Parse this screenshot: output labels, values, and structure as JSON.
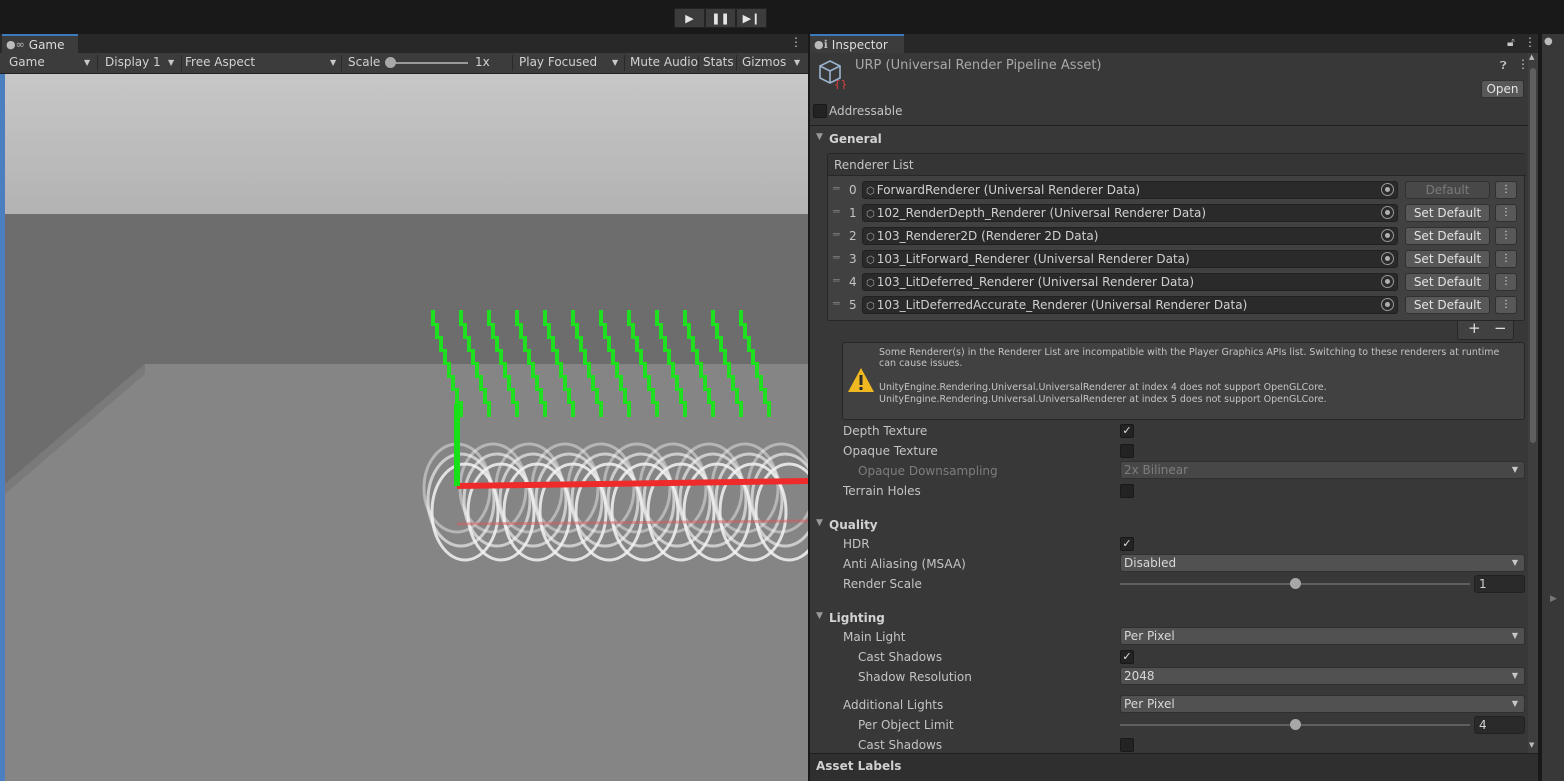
{
  "toolbar": {
    "play_icon": "play-icon",
    "pause_icon": "pause-icon",
    "step_icon": "step-icon"
  },
  "game": {
    "tab_label": "Game",
    "bar": {
      "view_select": "Game",
      "display": "Display 1",
      "aspect": "Free Aspect",
      "scale_label": "Scale",
      "scale_value": "1x",
      "scale_fraction": 0.0,
      "play_mode": "Play Focused",
      "mute_audio": "Mute Audio",
      "stats": "Stats",
      "gizmos": "Gizmos"
    }
  },
  "inspector": {
    "tab_label": "Inspector",
    "asset_title": "URP (Universal Render Pipeline Asset)",
    "open_label": "Open",
    "addressable_label": "Addressable",
    "addressable_checked": false,
    "general": {
      "title": "General",
      "renderer_list_label": "Renderer List",
      "renderers": [
        {
          "index": "0",
          "name": "ForwardRenderer (Universal Renderer Data)",
          "button": "Default",
          "is_default": true
        },
        {
          "index": "1",
          "name": "102_RenderDepth_Renderer (Universal Renderer Data)",
          "button": "Set Default",
          "is_default": false
        },
        {
          "index": "2",
          "name": "103_Renderer2D (Renderer 2D Data)",
          "button": "Set Default",
          "is_default": false
        },
        {
          "index": "3",
          "name": "103_LitForward_Renderer (Universal Renderer Data)",
          "button": "Set Default",
          "is_default": false
        },
        {
          "index": "4",
          "name": "103_LitDeferred_Renderer (Universal Renderer Data)",
          "button": "Set Default",
          "is_default": false
        },
        {
          "index": "5",
          "name": "103_LitDeferredAccurate_Renderer (Universal Renderer Data)",
          "button": "Set Default",
          "is_default": false
        }
      ],
      "add_label": "+",
      "remove_label": "−",
      "warning_lines": [
        "Some Renderer(s) in the Renderer List are incompatible with the Player Graphics APIs list.  Switching to these renderers at runtime",
        "can cause issues.",
        "UnityEngine.Rendering.Universal.UniversalRenderer at index 4 does not support OpenGLCore.",
        "UnityEngine.Rendering.Universal.UniversalRenderer at index 5 does not support OpenGLCore."
      ],
      "depth_texture_label": "Depth Texture",
      "depth_texture": true,
      "opaque_texture_label": "Opaque Texture",
      "opaque_texture": false,
      "opaque_downsampling_label": "Opaque Downsampling",
      "opaque_downsampling_value": "2x Bilinear",
      "terrain_holes_label": "Terrain Holes",
      "terrain_holes": false
    },
    "quality": {
      "title": "Quality",
      "hdr_label": "HDR",
      "hdr": true,
      "msaa_label": "Anti Aliasing (MSAA)",
      "msaa_value": "Disabled",
      "render_scale_label": "Render Scale",
      "render_scale_value": "1",
      "render_scale_fraction": 0.5
    },
    "lighting": {
      "title": "Lighting",
      "main_light_label": "Main Light",
      "main_light_value": "Per Pixel",
      "cast_shadows_label": "Cast Shadows",
      "main_cast_shadows": true,
      "shadow_resolution_label": "Shadow Resolution",
      "shadow_resolution_value": "2048",
      "additional_lights_label": "Additional Lights",
      "additional_lights_value": "Per Pixel",
      "per_object_limit_label": "Per Object Limit",
      "per_object_limit_value": "4",
      "per_object_limit_fraction": 0.5,
      "additional_cast_shadows_label": "Cast Shadows",
      "additional_cast_shadows": false
    },
    "asset_labels_title": "Asset Labels"
  }
}
